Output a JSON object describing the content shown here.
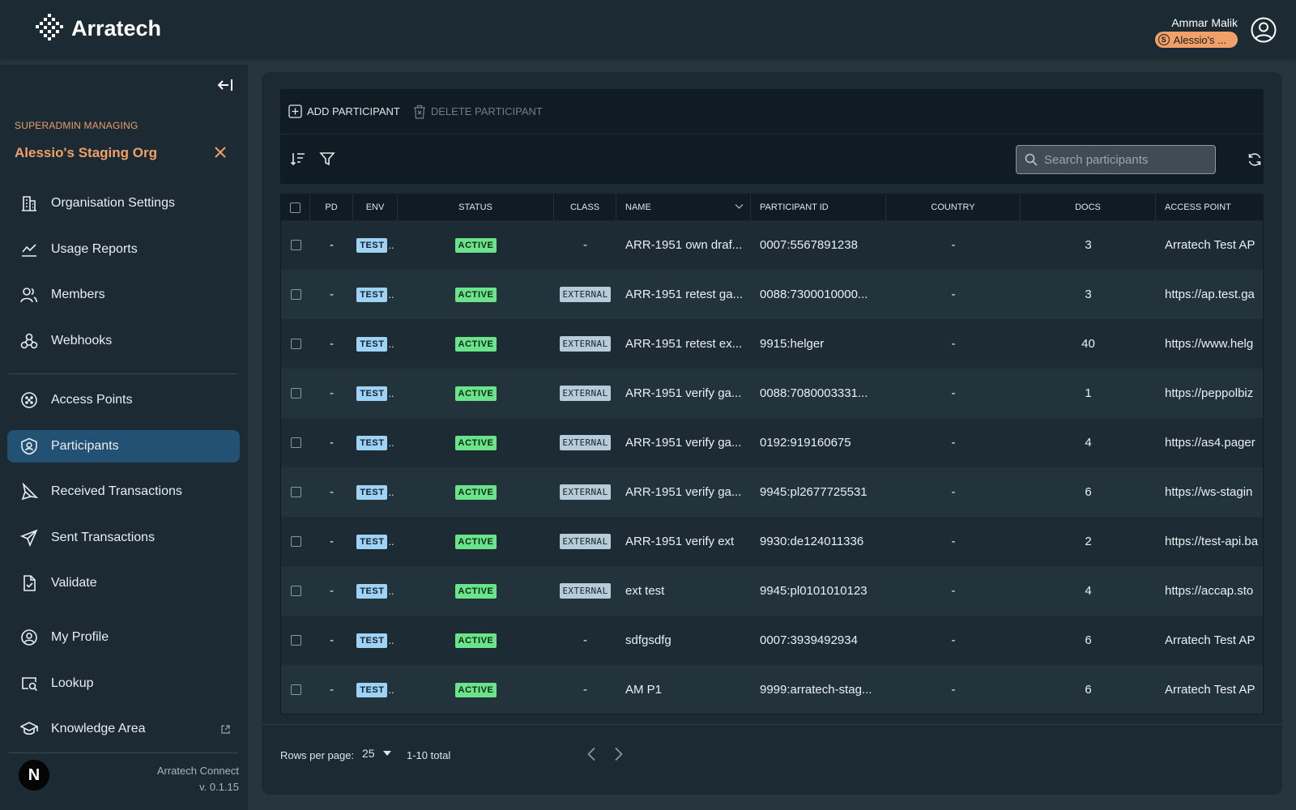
{
  "app": {
    "brand": "Arratech",
    "user_name": "Ammar Malik",
    "org_chip_letter": "S",
    "org_chip_label": "Alessio's ..."
  },
  "sidebar": {
    "managing_label": "SUPERADMIN MANAGING",
    "org_name": "Alessio's Staging Org",
    "items": [
      {
        "label": "Organisation Settings",
        "icon": "building-icon"
      },
      {
        "label": "Usage Reports",
        "icon": "chart-line-icon"
      },
      {
        "label": "Members",
        "icon": "members-icon"
      },
      {
        "label": "Webhooks",
        "icon": "webhook-icon"
      },
      {
        "label": "Access Points",
        "icon": "access-point-icon"
      },
      {
        "label": "Participants",
        "icon": "participant-badge-icon",
        "active": true
      },
      {
        "label": "Received Transactions",
        "icon": "received-icon"
      },
      {
        "label": "Sent Transactions",
        "icon": "send-icon"
      },
      {
        "label": "Validate",
        "icon": "document-check-icon"
      },
      {
        "label": "My Profile",
        "icon": "user-circle-icon"
      },
      {
        "label": "Lookup",
        "icon": "lookup-icon"
      },
      {
        "label": "Knowledge Area",
        "icon": "graduation-cap-icon",
        "external": true
      }
    ],
    "footer_product": "Arratech Connect",
    "footer_version": "v. 0.1.15",
    "footer_logo_letter": "N"
  },
  "toolbar": {
    "add_label": "ADD PARTICIPANT",
    "delete_label": "DELETE PARTICIPANT"
  },
  "search": {
    "placeholder": "Search participants"
  },
  "table": {
    "columns": [
      "PD",
      "ENV",
      "STATUS",
      "CLASS",
      "NAME",
      "PARTICIPANT ID",
      "COUNTRY",
      "DOCS",
      "ACCESS POINT"
    ],
    "rows": [
      {
        "pd": "-",
        "env": "TEST",
        "status": "ACTIVE",
        "class": "-",
        "name": "ARR-1951 own draf...",
        "pid": "0007:5567891238",
        "country": "-",
        "docs": "3",
        "ap": "Arratech Test AP"
      },
      {
        "pd": "-",
        "env": "TEST",
        "status": "ACTIVE",
        "class": "EXTERNAL",
        "name": "ARR-1951 retest ga...",
        "pid": "0088:7300010000...",
        "country": "-",
        "docs": "3",
        "ap": "https://ap.test.ga"
      },
      {
        "pd": "-",
        "env": "TEST",
        "status": "ACTIVE",
        "class": "EXTERNAL",
        "name": "ARR-1951 retest ex...",
        "pid": "9915:helger",
        "country": "-",
        "docs": "40",
        "ap": "https://www.helg"
      },
      {
        "pd": "-",
        "env": "TEST",
        "status": "ACTIVE",
        "class": "EXTERNAL",
        "name": "ARR-1951 verify ga...",
        "pid": "0088:7080003331...",
        "country": "-",
        "docs": "1",
        "ap": "https://peppolbiz"
      },
      {
        "pd": "-",
        "env": "TEST",
        "status": "ACTIVE",
        "class": "EXTERNAL",
        "name": "ARR-1951 verify ga...",
        "pid": "0192:919160675",
        "country": "-",
        "docs": "4",
        "ap": "https://as4.pager"
      },
      {
        "pd": "-",
        "env": "TEST",
        "status": "ACTIVE",
        "class": "EXTERNAL",
        "name": "ARR-1951 verify ga...",
        "pid": "9945:pl2677725531",
        "country": "-",
        "docs": "6",
        "ap": "https://ws-stagin"
      },
      {
        "pd": "-",
        "env": "TEST",
        "status": "ACTIVE",
        "class": "EXTERNAL",
        "name": "ARR-1951 verify ext",
        "pid": "9930:de124011336",
        "country": "-",
        "docs": "2",
        "ap": "https://test-api.ba"
      },
      {
        "pd": "-",
        "env": "TEST",
        "status": "ACTIVE",
        "class": "EXTERNAL",
        "name": "ext test",
        "pid": "9945:pl0101010123",
        "country": "-",
        "docs": "4",
        "ap": "https://accap.sto"
      },
      {
        "pd": "-",
        "env": "TEST",
        "status": "ACTIVE",
        "class": "-",
        "name": "sdfgsdfg",
        "pid": "0007:3939492934",
        "country": "-",
        "docs": "6",
        "ap": "Arratech Test AP"
      },
      {
        "pd": "-",
        "env": "TEST",
        "status": "ACTIVE",
        "class": "-",
        "name": "AM P1",
        "pid": "9999:arratech-stag...",
        "country": "-",
        "docs": "6",
        "ap": "Arratech Test AP"
      }
    ]
  },
  "pagination": {
    "rows_per_page_label": "Rows per page:",
    "rows_per_page_value": "25",
    "total_label": "1-10 total"
  },
  "colors": {
    "topbar": "#1b2a33",
    "accent_orange": "#f0a068",
    "active_nav": "#235173",
    "badge_test": "#9fd3f5",
    "badge_active": "#6be38a",
    "badge_external": "#b6ccd8"
  }
}
